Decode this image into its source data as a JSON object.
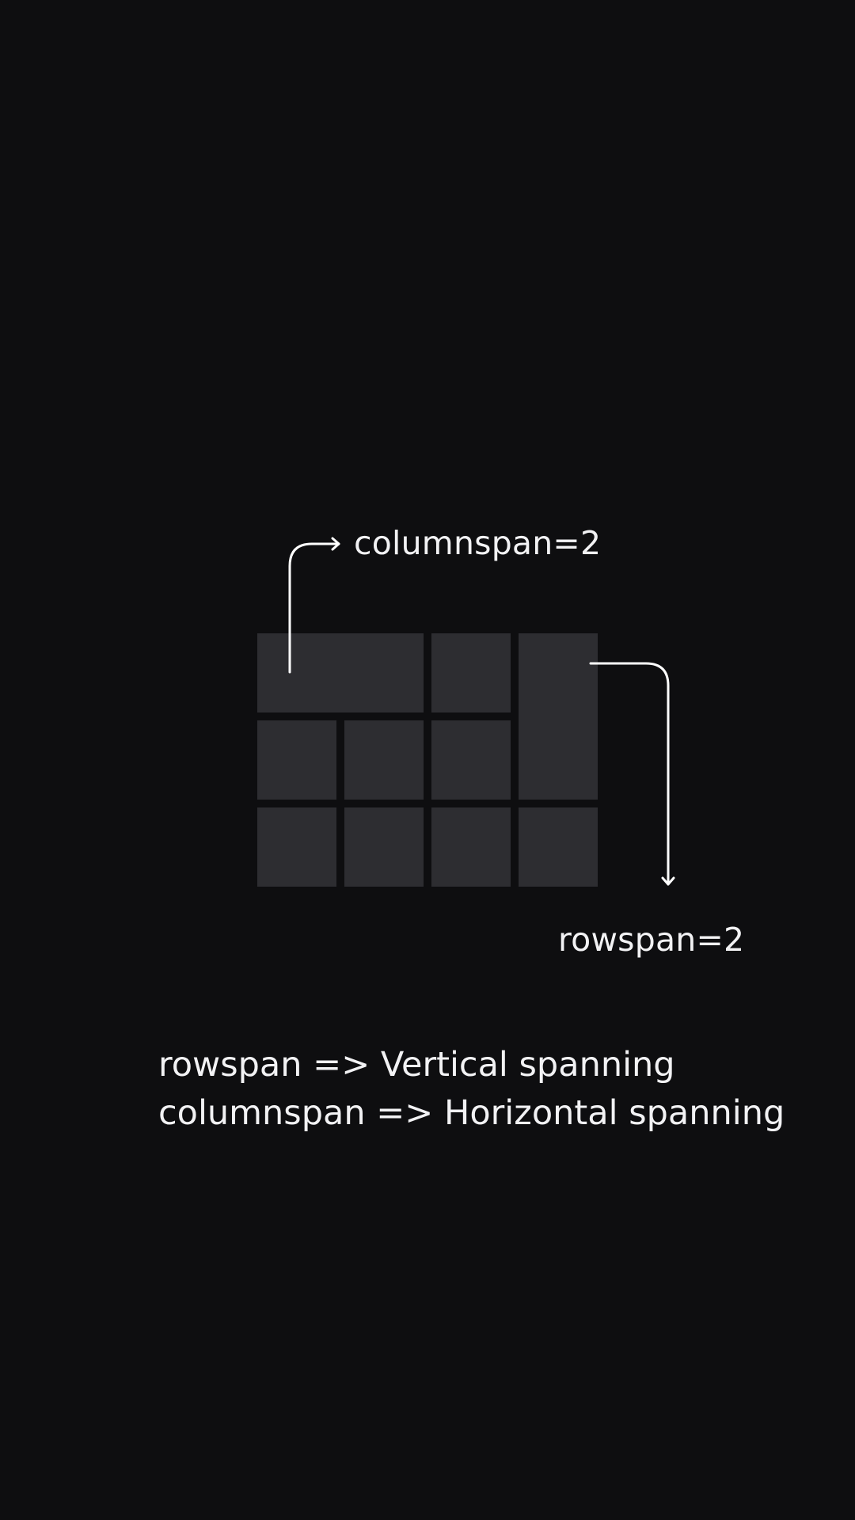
{
  "annotations": {
    "colspan_label": "columnspan=2",
    "rowspan_label": "rowspan=2"
  },
  "legend": {
    "line1": "rowspan => Vertical spanning",
    "line2": "columnspan => Horizontal spanning"
  },
  "grid": {
    "rows": 3,
    "columns": 4,
    "cells": [
      {
        "id": "r1-c1-c2",
        "row": 1,
        "col": 1,
        "rowspan": 1,
        "colspan": 2
      },
      {
        "id": "r1-c3",
        "row": 1,
        "col": 3,
        "rowspan": 1,
        "colspan": 1
      },
      {
        "id": "r1-r2-c4",
        "row": 1,
        "col": 4,
        "rowspan": 2,
        "colspan": 1
      },
      {
        "id": "r2-c1",
        "row": 2,
        "col": 1,
        "rowspan": 1,
        "colspan": 1
      },
      {
        "id": "r2-c2",
        "row": 2,
        "col": 2,
        "rowspan": 1,
        "colspan": 1
      },
      {
        "id": "r2-c3",
        "row": 2,
        "col": 3,
        "rowspan": 1,
        "colspan": 1
      },
      {
        "id": "r3-c1",
        "row": 3,
        "col": 1,
        "rowspan": 1,
        "colspan": 1
      },
      {
        "id": "r3-c2",
        "row": 3,
        "col": 2,
        "rowspan": 1,
        "colspan": 1
      },
      {
        "id": "r3-c3",
        "row": 3,
        "col": 3,
        "rowspan": 1,
        "colspan": 1
      },
      {
        "id": "r3-c4",
        "row": 3,
        "col": 4,
        "rowspan": 1,
        "colspan": 1
      }
    ]
  },
  "colors": {
    "background": "#0e0e10",
    "cell": "#2d2d31",
    "foreground": "#f2f2f4"
  }
}
